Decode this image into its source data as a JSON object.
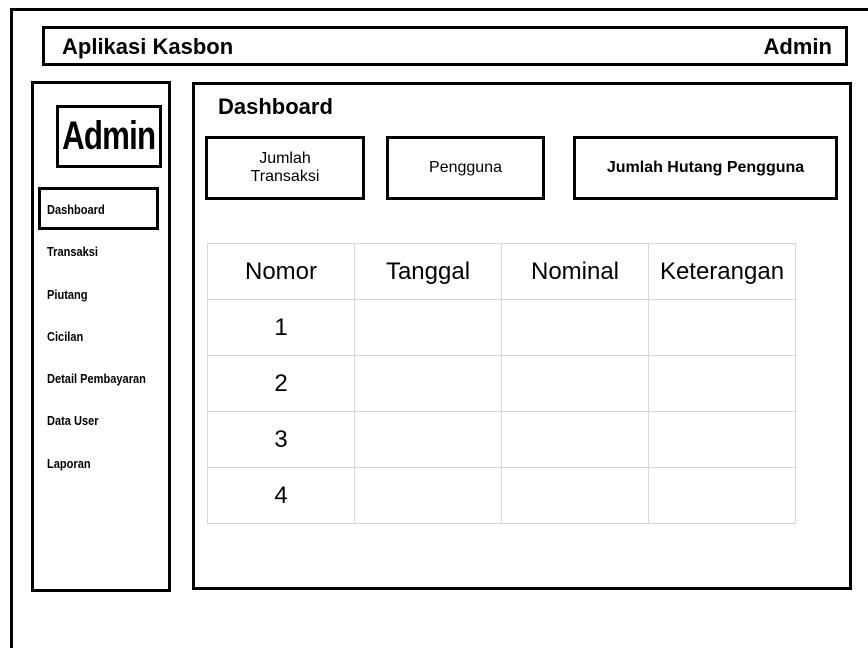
{
  "header": {
    "app_title": "Aplikasi Kasbon",
    "user_name": "Admin"
  },
  "sidebar": {
    "avatar_label": "Admin",
    "items": [
      {
        "label": "Dashboard",
        "active": true
      },
      {
        "label": "Transaksi",
        "active": false
      },
      {
        "label": "Piutang",
        "active": false
      },
      {
        "label": "Cicilan",
        "active": false
      },
      {
        "label": "Detail Pembayaran",
        "active": false
      },
      {
        "label": "Data User",
        "active": false
      },
      {
        "label": "Laporan",
        "active": false
      }
    ]
  },
  "main": {
    "page_title": "Dashboard",
    "cards": [
      {
        "label": "Jumlah\nTransaksi"
      },
      {
        "label": "Pengguna"
      },
      {
        "label": "Jumlah Hutang Pengguna"
      }
    ],
    "table": {
      "columns": [
        "Nomor",
        "Tanggal",
        "Nominal",
        "Keterangan"
      ],
      "rows": [
        [
          "1",
          "",
          "",
          ""
        ],
        [
          "2",
          "",
          "",
          ""
        ],
        [
          "3",
          "",
          "",
          ""
        ],
        [
          "4",
          "",
          "",
          ""
        ]
      ]
    }
  }
}
